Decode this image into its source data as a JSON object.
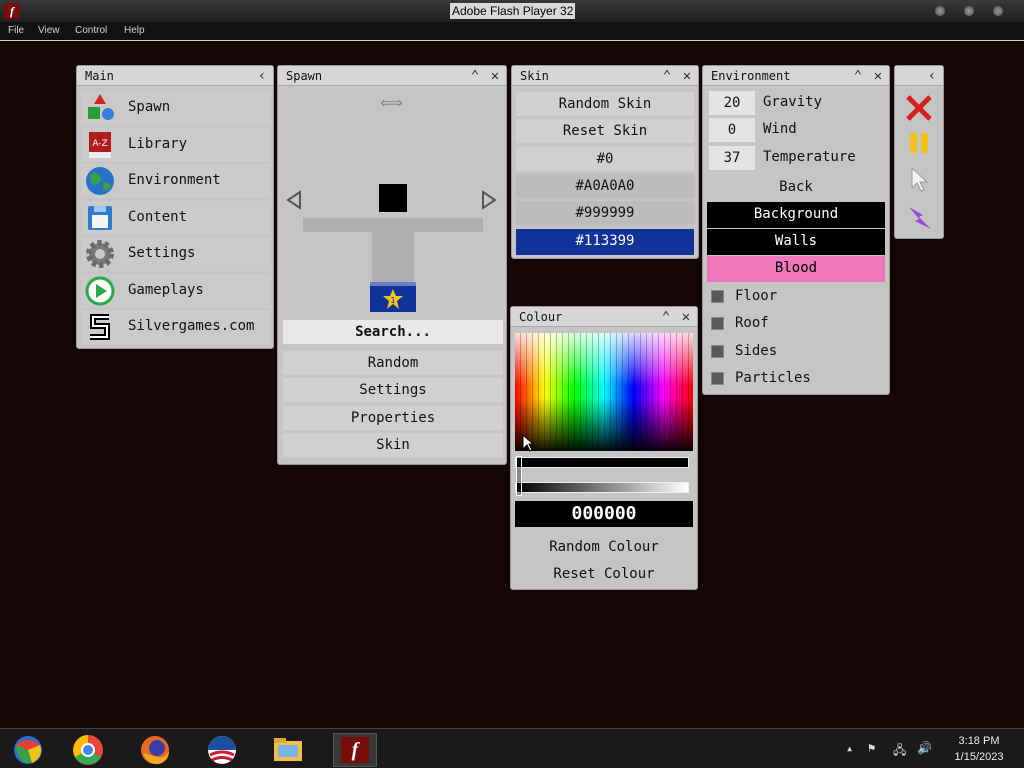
{
  "window": {
    "title": "Adobe Flash Player 32",
    "menu": [
      "File",
      "View",
      "Control",
      "Help"
    ]
  },
  "main_panel": {
    "title": "Main",
    "items": [
      {
        "label": "Spawn",
        "icon": "shapes-icon"
      },
      {
        "label": "Library",
        "icon": "book-icon"
      },
      {
        "label": "Environment",
        "icon": "globe-icon"
      },
      {
        "label": "Content",
        "icon": "floppy-disk-icon"
      },
      {
        "label": "Settings",
        "icon": "gear-icon"
      },
      {
        "label": "Gameplays",
        "icon": "play-icon"
      },
      {
        "label": "Silvergames.com",
        "icon": "silvergames-logo-icon"
      }
    ]
  },
  "spawn_panel": {
    "title": "Spawn",
    "search_label": "Search...",
    "buttons": [
      "Random",
      "Settings",
      "Properties",
      "Skin"
    ],
    "badge_number": "1"
  },
  "skin_panel": {
    "title": "Skin",
    "buttons": [
      "Random Skin",
      "Reset Skin"
    ],
    "colors": [
      {
        "label": "#0",
        "bg": "#d0d0d0"
      },
      {
        "label": "#A0A0A0",
        "bg": "#bdbdbd"
      },
      {
        "label": "#999999",
        "bg": "#bdbdbd"
      },
      {
        "label": "#113399",
        "bg": "#113399"
      }
    ]
  },
  "environment_panel": {
    "title": "Environment",
    "inputs": [
      {
        "value": "20",
        "label": "Gravity"
      },
      {
        "value": "0",
        "label": "Wind"
      },
      {
        "value": "37",
        "label": "Temperature"
      }
    ],
    "back_label": "Back",
    "layers": [
      {
        "label": "Background",
        "bg": "#000000",
        "color": "#ffffff"
      },
      {
        "label": "Walls",
        "bg": "#000000",
        "color": "#ffffff"
      },
      {
        "label": "Blood",
        "bg": "#ee77bb",
        "color": "#000000"
      }
    ],
    "checkboxes": [
      "Floor",
      "Roof",
      "Sides",
      "Particles"
    ]
  },
  "colour_panel": {
    "title": "Colour",
    "hex_value": "000000",
    "buttons": [
      "Random Colour",
      "Reset Colour"
    ]
  },
  "tools_panel": {
    "tools": [
      "close-x-icon",
      "pause-icon",
      "cursor-icon",
      "lightning-icon"
    ]
  },
  "taskbar": {
    "apps": [
      "windows-explorer-icon",
      "chrome-icon",
      "firefox-icon",
      "obama-logo-icon",
      "file-explorer-icon",
      "flash-player-icon"
    ],
    "time": "3:18 PM",
    "date": "1/15/2023"
  },
  "colors": {
    "background": "#140607",
    "panel": "#c5c5c5",
    "selected_skin": "#113399",
    "pink": "#ee77bb"
  }
}
